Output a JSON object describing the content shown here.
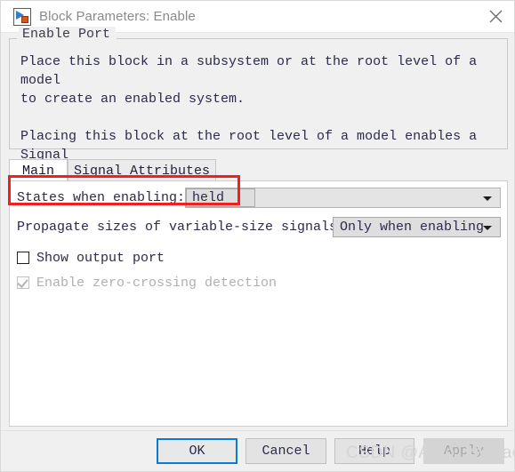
{
  "window": {
    "title": "Block Parameters: Enable",
    "icon": "simulink-block-icon",
    "close_icon": "close-icon"
  },
  "group": {
    "label": "Enable Port",
    "description": "Place this block in a subsystem or at the root level of a model\nto create an enabled system.\n\nPlacing this block at the root level of a model enables a Signal\nAttributes tab."
  },
  "tabs": [
    {
      "label": "Main",
      "active": true
    },
    {
      "label": "Signal Attributes",
      "active": false
    }
  ],
  "main_tab": {
    "states_when_enabling": {
      "label": "States when enabling:",
      "value": "held",
      "highlighted": true,
      "highlight_color": "#f21f1f"
    },
    "propagate_sizes": {
      "label": "Propagate sizes of variable-size signals:",
      "value": "Only when enabling"
    },
    "show_output_port": {
      "label": "Show output port",
      "checked": false,
      "enabled": true
    },
    "enable_zero_crossing": {
      "label": "Enable zero-crossing detection",
      "checked": true,
      "enabled": false
    }
  },
  "buttons": {
    "ok": "OK",
    "cancel": "Cancel",
    "help": "Help",
    "apply": "Apply",
    "apply_enabled": false,
    "default_focus_color": "#0a7ad4"
  },
  "watermark": "CSDN @Auto_yaoyao"
}
